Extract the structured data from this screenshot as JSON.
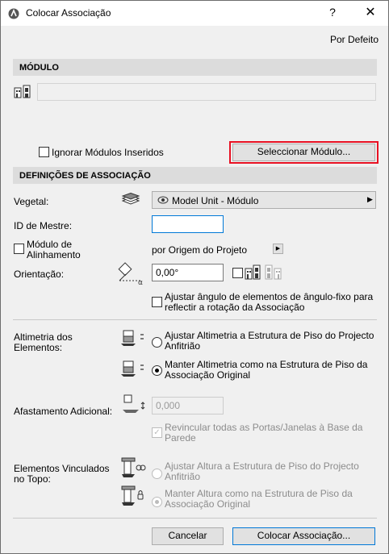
{
  "window": {
    "title": "Colocar Associação",
    "help_glyph": "?",
    "close_glyph": "✕"
  },
  "top_link": "Por Defeito",
  "module_section": {
    "header": "MÓDULO",
    "ignore_checkbox_label": "Ignorar Módulos Inseridos",
    "select_button_label": "Seleccionar Módulo..."
  },
  "settings_section": {
    "header": "DEFINIÇÕES DE ASSOCIAÇÃO",
    "vegetal_label": "Vegetal:",
    "vegetal_value": "Model Unit - Módulo",
    "master_id_label": "ID de Mestre:",
    "master_id_value": "",
    "alignment_label_1": "Módulo de",
    "alignment_label_2": "Alinhamento",
    "alignment_value": "por Origem do Projeto",
    "orientation_label": "Orientação:",
    "orientation_value": "0,00°",
    "adjust_angle_line1": "Ajustar ângulo de elementos de ângulo-fixo para",
    "adjust_angle_line2": "reflectir a rotação da Associação"
  },
  "elevation": {
    "label_1": "Altimetria dos",
    "label_2": "Elementos:",
    "opt1_line1": "Ajustar Altimetria a Estrutura de Piso do Projecto",
    "opt1_line2": "Anfitrião",
    "opt2_line1": "Manter Altimetria como na Estrutura de Piso da",
    "opt2_line2": "Associação Original",
    "selected": 2
  },
  "offset": {
    "label": "Afastamento Adicional:",
    "value": "0,000",
    "relink_line1": "Revincular todas as Portas/Janelas à Base da",
    "relink_line2": "Parede",
    "relink_checked": true
  },
  "top_linked": {
    "label_1": "Elementos Vinculados",
    "label_2": "no Topo:",
    "opt1_line1": "Ajustar Altura a Estrutura de Piso do Projecto",
    "opt1_line2": "Anfitrião",
    "opt2_line1": "Manter Altura como na Estrutura de Piso da",
    "opt2_line2": "Associação Original",
    "selected": 2
  },
  "footer": {
    "cancel_label": "Cancelar",
    "place_label": "Colocar Associação..."
  },
  "colors": {
    "highlight_border": "#e81123",
    "section_bg": "#dcdcdc",
    "dialog_bg": "#f0f0f0"
  }
}
